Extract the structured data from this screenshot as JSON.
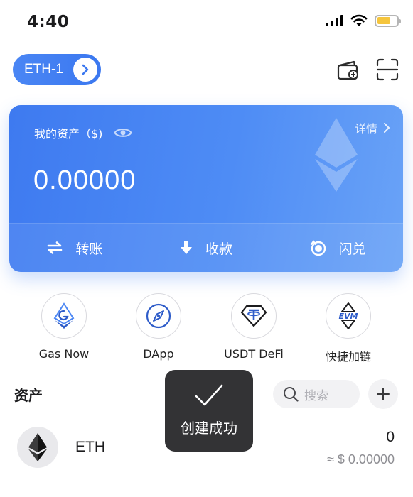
{
  "status_bar": {
    "time": "4:40"
  },
  "header": {
    "wallet_name": "ETH-1"
  },
  "asset_card": {
    "title": "我的资产（$)",
    "detail_label": "详情",
    "balance": "0.00000",
    "actions": [
      {
        "label": "转账",
        "icon": "transfer-icon"
      },
      {
        "label": "收款",
        "icon": "receive-icon"
      },
      {
        "label": "闪兑",
        "icon": "swap-icon"
      }
    ]
  },
  "quick_apps": [
    {
      "label": "Gas Now",
      "icon": "gas-now-icon"
    },
    {
      "label": "DApp",
      "icon": "compass-icon"
    },
    {
      "label": "USDT DeFi",
      "icon": "usdt-icon"
    },
    {
      "label": "快捷加链",
      "icon": "evm-icon"
    }
  ],
  "assets": {
    "title": "资产",
    "search_placeholder": "搜索",
    "tokens": [
      {
        "symbol": "ETH",
        "amount": "0",
        "fiat_value": "≈ $ 0.00000",
        "icon": "eth-icon"
      }
    ]
  },
  "toast": {
    "message": "创建成功",
    "icon": "checkmark-icon"
  },
  "colors": {
    "accent": "#3e7af0",
    "battery": "#f5c53d",
    "toast_bg": "#242426"
  }
}
